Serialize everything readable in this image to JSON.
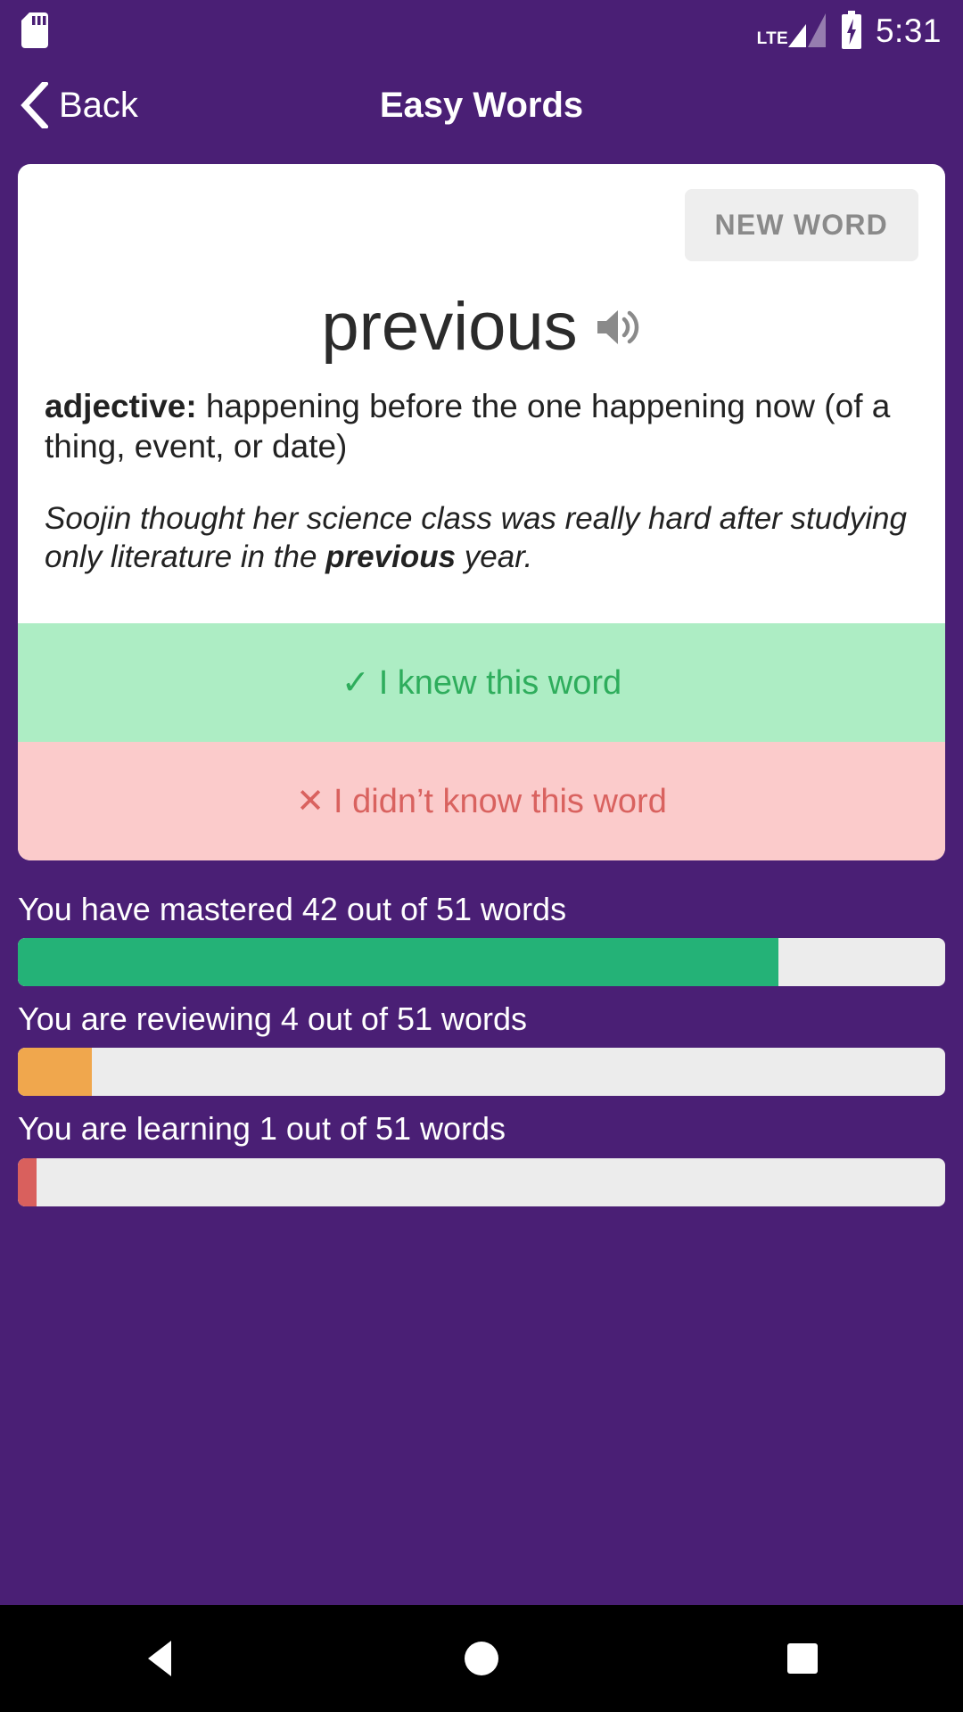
{
  "status_bar": {
    "sd_card_icon": "sd-card-icon",
    "network_label": "LTE",
    "signal_icon": "signal-bars-icon",
    "battery_icon": "battery-charging-icon",
    "time": "5:31"
  },
  "header": {
    "back_icon": "chevron-left-icon",
    "back_label": "Back",
    "title": "Easy Words"
  },
  "card": {
    "new_word_button": "NEW WORD",
    "word": "previous",
    "speaker_icon": "speaker-icon",
    "definition": {
      "part_of_speech": "adjective:",
      "text": " happening before the one happening now (of a thing, event, or date)"
    },
    "example": {
      "before": "Soojin thought her science class was really hard after studying only literature in the ",
      "highlight": "previous",
      "after": " year."
    },
    "answers": [
      {
        "mark": "✓",
        "label": "I knew this word",
        "bg": "#ADEDC4",
        "color": "#2EAD5C"
      },
      {
        "mark": "✕",
        "label": "I didn’t know this word",
        "bg": "#FBCBCB",
        "color": "#D9625F"
      }
    ]
  },
  "stats": [
    {
      "label": "You have mastered 42 out of 51 words",
      "value": 42,
      "total": 51,
      "percent": 82,
      "color": "#24B277"
    },
    {
      "label": "You are reviewing 4 out of 51 words",
      "value": 4,
      "total": 51,
      "percent": 8,
      "color": "#F0A74D"
    },
    {
      "label": "You are learning 1 out of 51 words",
      "value": 1,
      "total": 51,
      "percent": 2,
      "color": "#D9605D"
    }
  ],
  "nav_bar": {
    "back_icon": "nav-back-triangle-icon",
    "home_icon": "nav-home-circle-icon",
    "recents_icon": "nav-recents-square-icon"
  },
  "theme": {
    "purple": "#4A1F75",
    "card_bg": "#FFFFFF",
    "track": "#ECECEC"
  }
}
